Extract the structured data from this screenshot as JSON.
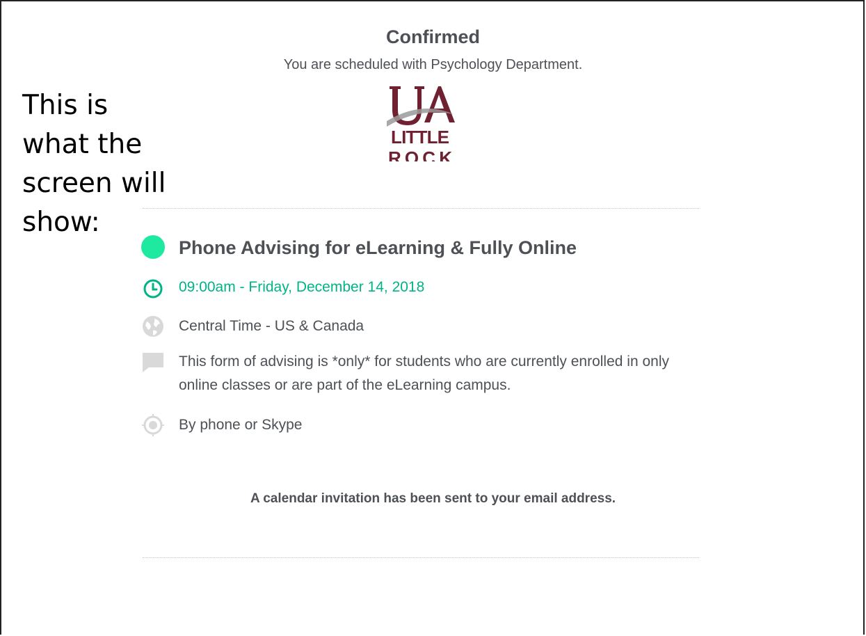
{
  "header": {
    "title": "Confirmed",
    "subtitle": "You are scheduled with Psychology Department."
  },
  "annotation": {
    "text": "This is what the screen will show:"
  },
  "logo": {
    "alt_text": "UA LITTLE ROCK"
  },
  "event": {
    "name": "Phone Advising for eLearning & Fully Online",
    "color": "#1de9a0",
    "time": "09:00am - Friday, December 14, 2018",
    "timezone": "Central Time - US & Canada",
    "description": "This form of advising is *only* for students who are currently enrolled in only online classes or are part of the eLearning campus.",
    "location": "By phone or Skype"
  },
  "notice": "A calendar invitation has been sent to your email address.",
  "colors": {
    "text": "#4d5055",
    "accent": "#00b487",
    "icon_gray": "#d9d9d9",
    "brand_maroon": "#6f2132"
  },
  "icons": [
    "color-dot-icon",
    "clock-icon",
    "globe-icon",
    "comment-icon",
    "location-target-icon"
  ]
}
